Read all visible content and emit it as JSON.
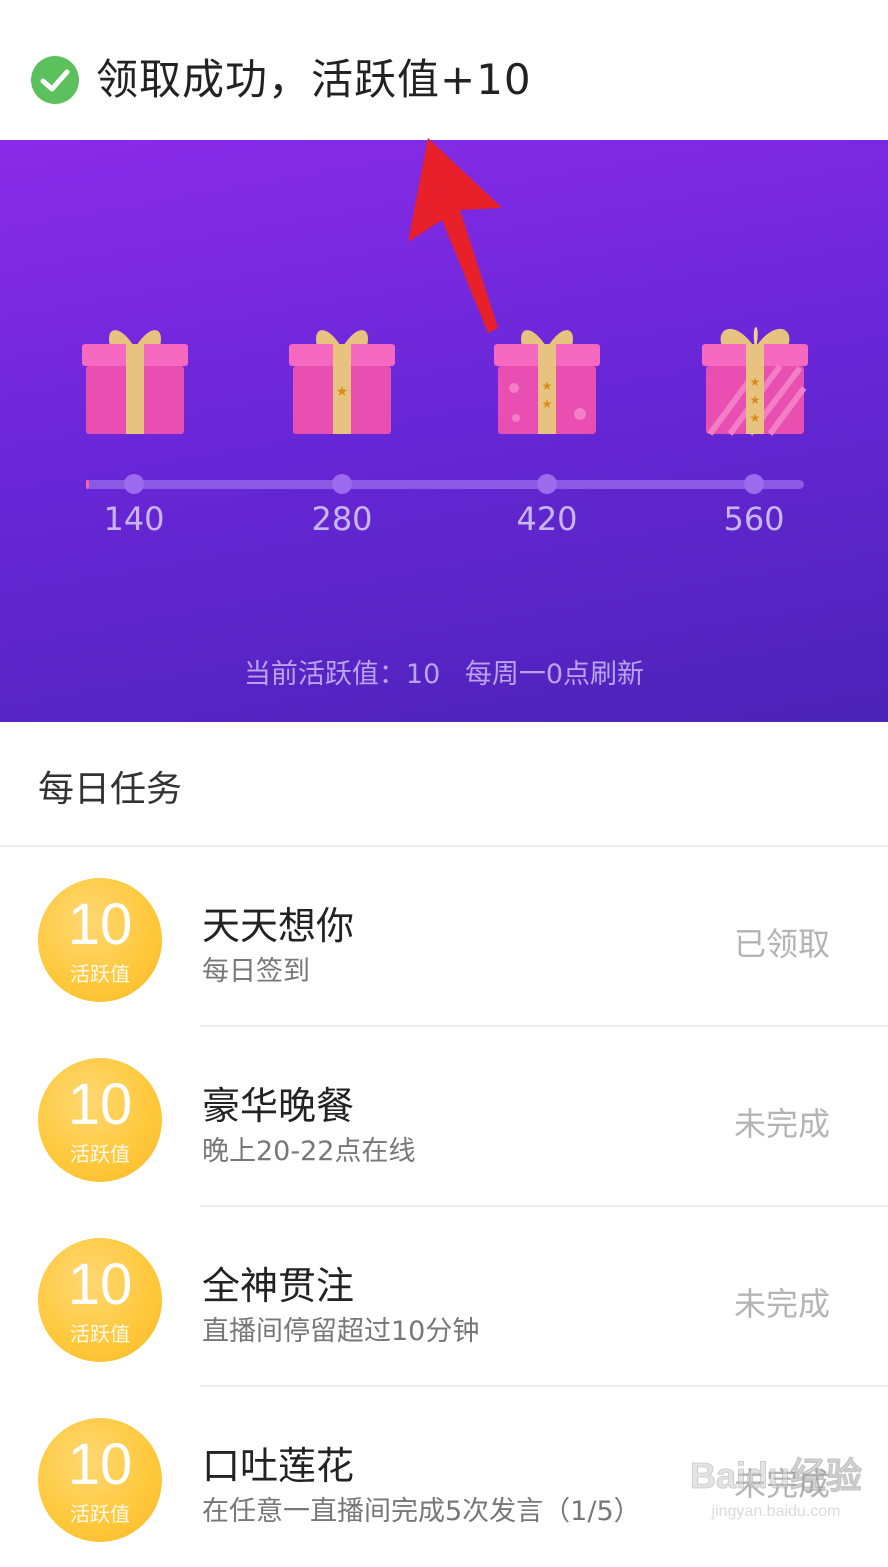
{
  "toast": {
    "message": "领取成功，活跃值+10",
    "icon": "check-circle-icon",
    "color": "#5cc15c"
  },
  "hero": {
    "milestones": [
      {
        "label": "140",
        "gift": "gift-box-1-icon"
      },
      {
        "label": "280",
        "gift": "gift-box-2-icon"
      },
      {
        "label": "420",
        "gift": "gift-box-3-icon"
      },
      {
        "label": "560",
        "gift": "gift-box-4-icon"
      }
    ],
    "progress_value": 10,
    "progress_max": 560,
    "status_current": "当前活跃值：10",
    "status_refresh": "每周一0点刷新"
  },
  "section": {
    "title": "每日任务"
  },
  "tasks": [
    {
      "points": "10",
      "unit": "活跃值",
      "name": "天天想你",
      "desc": "每日签到",
      "status": "已领取"
    },
    {
      "points": "10",
      "unit": "活跃值",
      "name": "豪华晚餐",
      "desc": "晚上20-22点在线",
      "status": "未完成"
    },
    {
      "points": "10",
      "unit": "活跃值",
      "name": "全神贯注",
      "desc": "直播间停留超过10分钟",
      "status": "未完成"
    },
    {
      "points": "10",
      "unit": "活跃值",
      "name": "口吐莲花",
      "desc": "在任意一直播间完成5次发言（1/5）",
      "status": "未完成"
    }
  ],
  "watermark": {
    "text": "Baidu经验",
    "subtext": "jingyan.baidu.com"
  },
  "colors": {
    "hero_top": "#8a2be8",
    "hero_bottom": "#4b23b8",
    "badge": "#ffc83a",
    "arrow": "#e8202a"
  }
}
